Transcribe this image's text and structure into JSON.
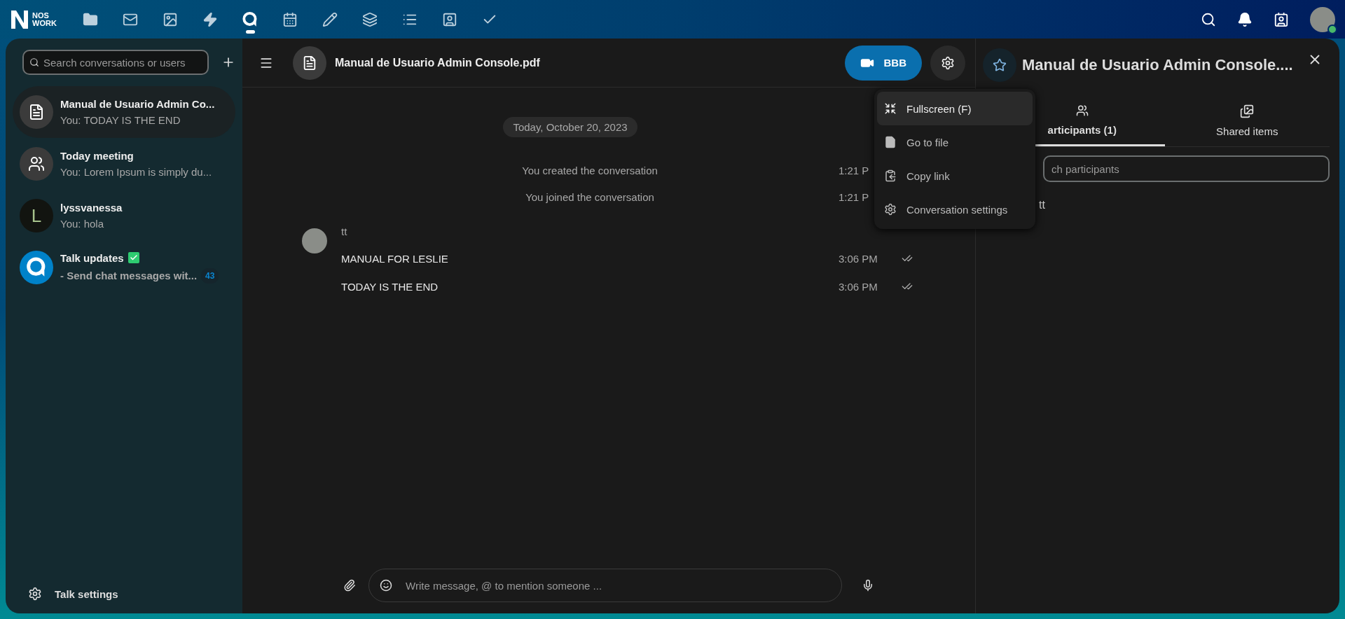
{
  "top_nav": {
    "logo": {
      "line1": "NOS",
      "line2": "WORK"
    },
    "apps": [
      {
        "kind": "files",
        "selected": false
      },
      {
        "kind": "mail",
        "selected": false
      },
      {
        "kind": "photos",
        "selected": false
      },
      {
        "kind": "activity",
        "selected": false
      },
      {
        "kind": "talk",
        "selected": true
      },
      {
        "kind": "calendar",
        "selected": false
      },
      {
        "kind": "notes",
        "selected": false
      },
      {
        "kind": "deck",
        "selected": false
      },
      {
        "kind": "tasks",
        "selected": false
      },
      {
        "kind": "contacts",
        "selected": false
      },
      {
        "kind": "check",
        "selected": false
      }
    ],
    "user": {
      "online": true
    }
  },
  "sidebar": {
    "search": {
      "placeholder": "Search conversations or users"
    },
    "conversations": [
      {
        "kind": "file",
        "name": "Manual de Usuario Admin Co...",
        "preview": "You: TODAY IS THE END",
        "selected": true,
        "verified": false,
        "bold_preview": false
      },
      {
        "kind": "group",
        "name": "Today meeting",
        "preview": "You: Lorem Ipsum is simply du...",
        "selected": false,
        "verified": false,
        "bold_preview": false
      },
      {
        "kind": "user",
        "avatar_letter": "L",
        "name": "lyssvanessa",
        "preview": "You: hola",
        "selected": false,
        "verified": false,
        "bold_preview": false
      },
      {
        "kind": "bot",
        "name": "Talk updates",
        "preview": "- Send chat messages wit...",
        "selected": false,
        "verified": true,
        "bold_preview": true,
        "unread": "43"
      }
    ],
    "footer": "Talk settings"
  },
  "chat": {
    "title": "Manual de Usuario Admin Console.pdf",
    "call_button": "BBB",
    "date": "Today, October 20, 2023",
    "system_messages": [
      {
        "text": "You created the conversation",
        "time": "1:21 P"
      },
      {
        "text": "You joined the conversation",
        "time": "1:21 P"
      }
    ],
    "author": "tt",
    "messages": [
      {
        "text": "MANUAL FOR LESLIE",
        "time": "3:06 PM",
        "read": true
      },
      {
        "text": "TODAY IS THE END",
        "time": "3:06 PM",
        "read": true
      }
    ],
    "composer": {
      "placeholder": "Write message, @ to mention someone ..."
    },
    "menu": [
      {
        "kind": "fullscreen",
        "label": "Fullscreen (F)",
        "selected": true
      },
      {
        "kind": "file",
        "label": "Go to file",
        "selected": false
      },
      {
        "kind": "copy",
        "label": "Copy link",
        "selected": false
      },
      {
        "kind": "settings",
        "label": "Conversation settings",
        "selected": false
      }
    ]
  },
  "details": {
    "title": "Manual de Usuario Admin Console....",
    "tabs": [
      {
        "kind": "participants",
        "label": "articipants (1)",
        "selected": true
      },
      {
        "kind": "shared",
        "label": "Shared items",
        "selected": false
      }
    ],
    "search": {
      "placeholder": "ch participants"
    },
    "participants": [
      "tt"
    ]
  }
}
